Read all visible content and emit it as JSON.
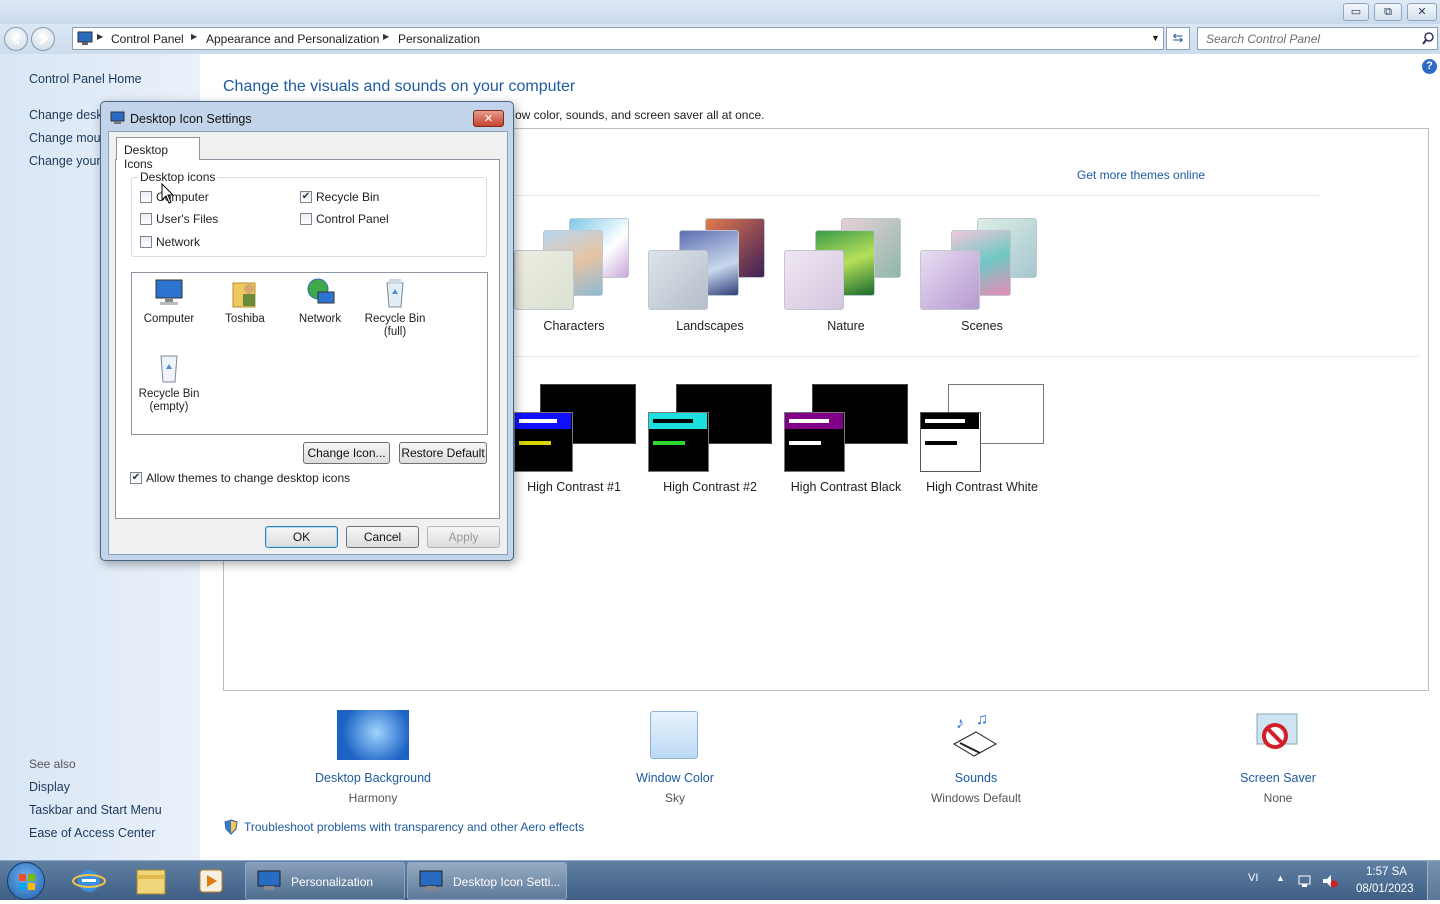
{
  "window": {
    "minimize": "▭",
    "restore": "⧉",
    "close": "✕"
  },
  "address": {
    "segments": [
      "Control Panel",
      "Appearance and Personalization",
      "Personalization"
    ],
    "search_placeholder": "Search Control Panel"
  },
  "sidebar": {
    "home": "Control Panel Home",
    "links": [
      "Change desktop icons",
      "Change mouse pointers",
      "Change your account picture"
    ],
    "links_visible": [
      "Change deskt",
      "Change mous",
      "Change your"
    ],
    "see_also_title": "See also",
    "see_also": [
      "Display",
      "Taskbar and Start Menu",
      "Ease of Access Center"
    ]
  },
  "main": {
    "heading": "Change the visuals and sounds on your computer",
    "subtext": "ow color, sounds, and screen saver all at once.",
    "get_more": "Get more themes online",
    "aero_themes": [
      "Characters",
      "Landscapes",
      "Nature",
      "Scenes"
    ],
    "hc_themes": [
      "High Contrast #1",
      "High Contrast #2",
      "High Contrast Black",
      "High Contrast White"
    ],
    "bottom": [
      {
        "title": "Desktop Background",
        "sub": "Harmony"
      },
      {
        "title": "Window Color",
        "sub": "Sky"
      },
      {
        "title": "Sounds",
        "sub": "Windows Default"
      },
      {
        "title": "Screen Saver",
        "sub": "None"
      }
    ],
    "troubleshoot": "Troubleshoot problems with transparency and other Aero effects"
  },
  "dialog": {
    "title": "Desktop Icon Settings",
    "tab": "Desktop Icons",
    "group_label": "Desktop icons",
    "checkboxes": [
      {
        "label": "Computer",
        "checked": false
      },
      {
        "label": "Recycle Bin",
        "checked": true
      },
      {
        "label": "User's Files",
        "checked": false
      },
      {
        "label": "Control Panel",
        "checked": false
      },
      {
        "label": "Network",
        "checked": false
      }
    ],
    "icons": [
      "Computer",
      "Toshiba",
      "Network",
      "Recycle Bin (full)",
      "Recycle Bin (empty)"
    ],
    "change_icon": "Change Icon...",
    "restore_default": "Restore Default",
    "allow_themes": "Allow themes to change desktop icons",
    "allow_themes_checked": true,
    "ok": "OK",
    "cancel": "Cancel",
    "apply": "Apply"
  },
  "taskbar": {
    "tasks": [
      "Personalization",
      "Desktop Icon Setti..."
    ],
    "lang": "VI",
    "time": "1:57 SA",
    "date": "08/01/2023"
  }
}
